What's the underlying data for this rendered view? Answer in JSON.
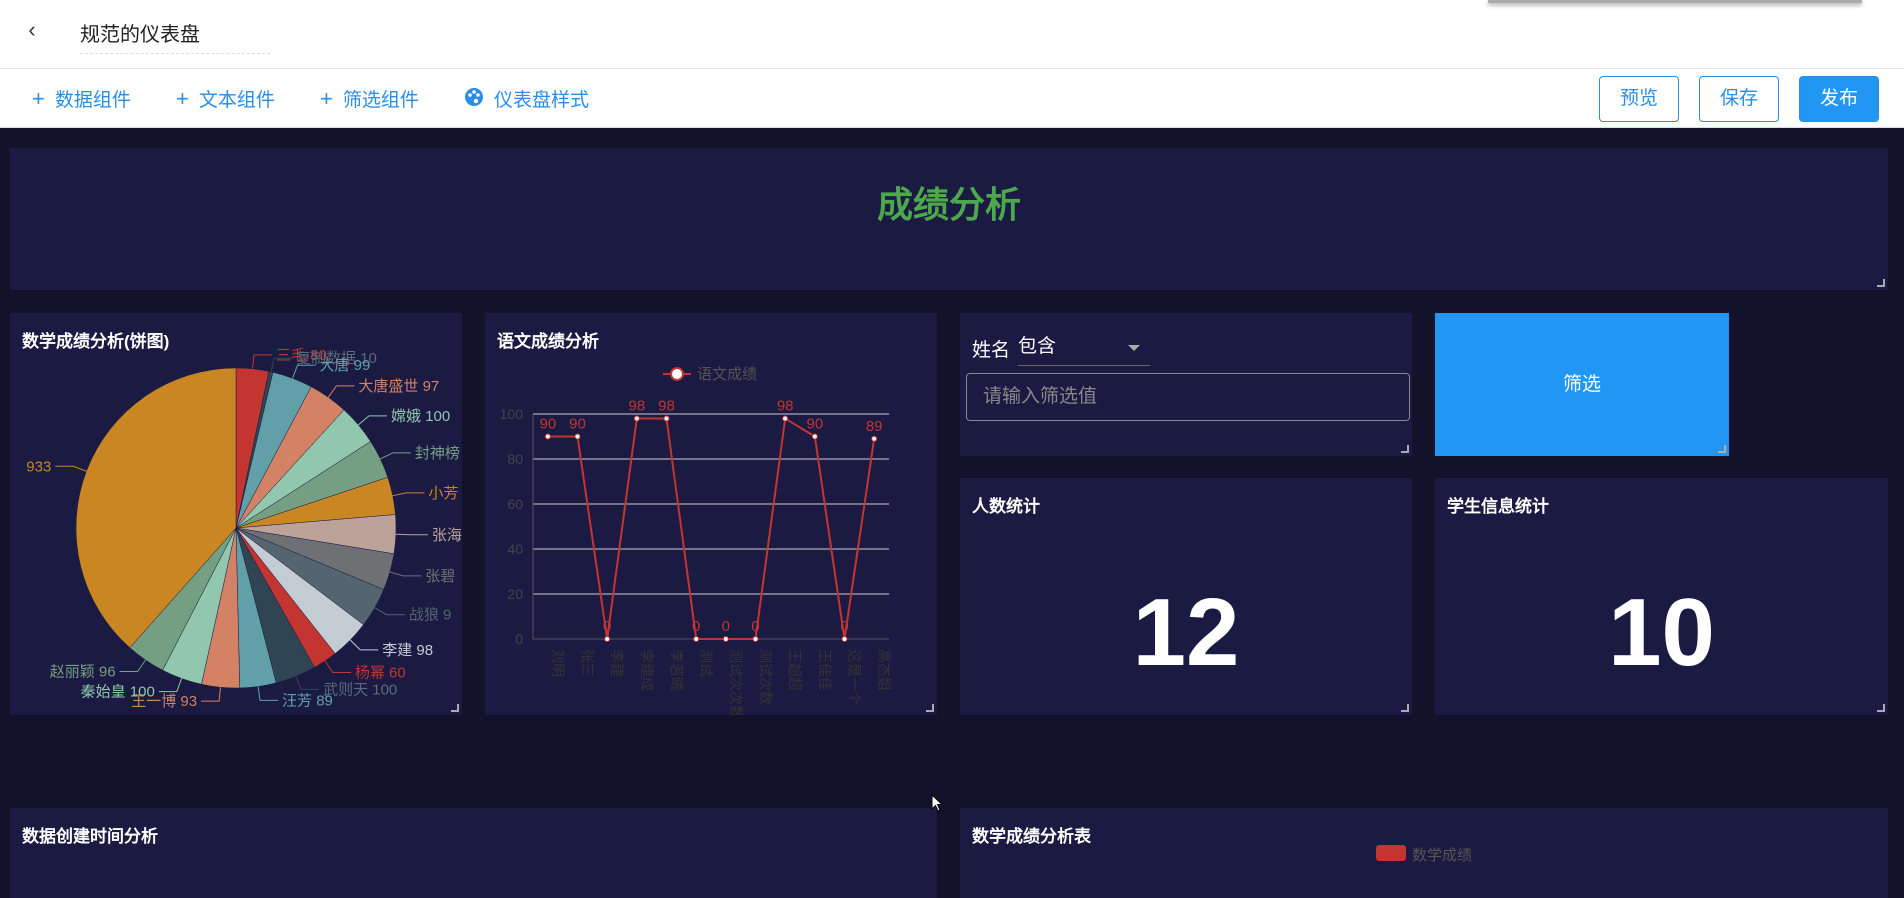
{
  "header": {
    "back_icon": "chevron-left-icon",
    "title": "规范的仪表盘"
  },
  "toolbar": {
    "items": [
      {
        "icon": "plus-icon",
        "label": "数据组件"
      },
      {
        "icon": "plus-icon",
        "label": "文本组件"
      },
      {
        "icon": "plus-icon",
        "label": "筛选组件"
      },
      {
        "icon": "palette-icon",
        "label": "仪表盘样式"
      }
    ],
    "preview": "预览",
    "save": "保存",
    "publish": "发布"
  },
  "dashboard": {
    "title": "成绩分析",
    "title_color": "#4ca84c",
    "math_pie": {
      "title": "数学成绩分析(饼图)"
    },
    "chinese_line": {
      "title": "语文成绩分析"
    },
    "filter": {
      "field": "姓名",
      "operator": "包含",
      "placeholder": "请输入筛选值",
      "button": "筛选"
    },
    "count": {
      "title": "人数统计",
      "value": "12"
    },
    "student_info": {
      "title": "学生信息统计",
      "value": "10"
    },
    "created_time": {
      "title": "数据创建时间分析"
    },
    "math_table": {
      "title": "数学成绩分析表",
      "legend": "数学成绩"
    }
  },
  "chart_data": [
    {
      "type": "pie",
      "title": "数学成绩分析(饼图)",
      "slices": [
        {
          "label": "三毛 80",
          "name": "三毛",
          "value": 80,
          "color": "#c23531"
        },
        {
          "label": "复制数据 10",
          "name": "复制数据",
          "value": 10,
          "color": "#2f4554"
        },
        {
          "label": "大唐 99",
          "name": "大唐",
          "value": 99,
          "color": "#61a0a8"
        },
        {
          "label": "大唐盛世 97",
          "name": "大唐盛世",
          "value": 97,
          "color": "#d48265"
        },
        {
          "label": "嫦娥 100",
          "name": "嫦娥",
          "value": 100,
          "color": "#91c7ae"
        },
        {
          "label": "封神榜",
          "name": "封神榜",
          "value": 96,
          "color": "#749f83"
        },
        {
          "label": "小芳",
          "name": "小芳",
          "value": 92,
          "color": "#ca8622"
        },
        {
          "label": "张海",
          "name": "张海",
          "value": 95,
          "color": "#bda29a"
        },
        {
          "label": "张碧",
          "name": "张碧",
          "value": 90,
          "color": "#6e7074"
        },
        {
          "label": "战狼 9",
          "name": "战狼",
          "value": 98,
          "color": "#546570"
        },
        {
          "label": "李建 98",
          "name": "李建",
          "value": 98,
          "color": "#c4ccd3"
        },
        {
          "label": "杨幂 60",
          "name": "杨幂",
          "value": 60,
          "color": "#c23531"
        },
        {
          "label": "武则天 100",
          "name": "武则天",
          "value": 100,
          "color": "#2f4554"
        },
        {
          "label": "汪芳 89",
          "name": "汪芳",
          "value": 89,
          "color": "#61a0a8"
        },
        {
          "label": "王一博 93",
          "name": "王一博",
          "value": 93,
          "color": "#d48265"
        },
        {
          "label": "秦始皇 100",
          "name": "秦始皇",
          "value": 100,
          "color": "#91c7ae"
        },
        {
          "label": "赵丽颖 96",
          "name": "赵丽颖",
          "value": 96,
          "color": "#749f83"
        },
        {
          "label": "933",
          "name": "",
          "value": 933,
          "color": "#ca8622"
        }
      ]
    },
    {
      "type": "line",
      "title": "语文成绩分析",
      "series": [
        {
          "name": "语文成绩",
          "color": "#c23531",
          "values": [
            90,
            90,
            0,
            98,
            98,
            0,
            0,
            0,
            98,
            90,
            0,
            89
          ]
        }
      ],
      "categories": [
        "刘明",
        "张三",
        "李建",
        "李建成",
        "李若曦",
        "测试",
        "测试次次数",
        "测试次数",
        "王超超",
        "王佳佳",
        "这是一个",
        "高杰姐"
      ],
      "data_labels": [
        "90",
        "90",
        "0",
        "98",
        "98",
        "0",
        "0",
        "0",
        "98",
        "90",
        "0",
        "89"
      ],
      "yticks": [
        "0",
        "20",
        "40",
        "60",
        "80",
        "100"
      ],
      "ylim": [
        0,
        100
      ]
    }
  ]
}
